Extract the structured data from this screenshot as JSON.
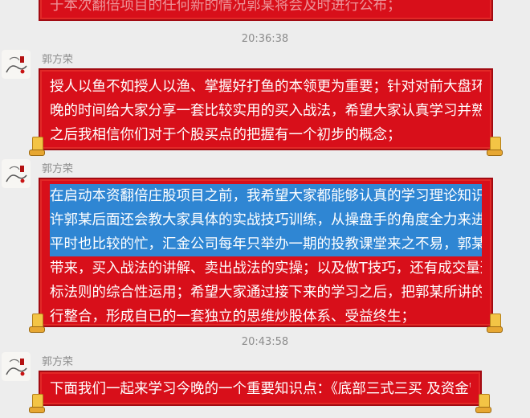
{
  "chat": {
    "messages": [
      {
        "kind": "text",
        "partial": true,
        "lines": [
          "于本次翻倍项目的任何新的情况郭某将会及时进行公布；"
        ]
      },
      {
        "kind": "time",
        "text": "20:36:38"
      },
      {
        "kind": "text",
        "sender": "郭方荣",
        "lines": [
          "授人以鱼不如授人以渔、掌握好打鱼的本领更为重要；针对对前大盘环境郭某利用今",
          "晚的时间给大家分享一套比较实用的买入战法，希望大家认真学习并熟练掌握；学完",
          "之后我相信你们对于个股买点的把握有一个初步的概念；"
        ]
      },
      {
        "kind": "text",
        "sender": "郭方荣",
        "highlighted_lines": [
          "在启动本资翻倍庄股项目之前，我希望大家都能够认真的学习理论知识，如果时间允",
          "许郭某后面还会教大家具体的实战技巧训练，从操盘手的角度全力来进行打造；郭某",
          "平时也比较的忙，汇金公司每年只举办一期的投教课堂来之不易，郭某会相继给大家"
        ],
        "lines": [
          "带来，买入战法的讲解、卖出战法的实操；以及做T技巧，还有成交量选股、及各种指",
          "标法则的综合性运用；希望大家通过接下来的学习之后，把郭某所讲的零碎知识点进",
          "行整合，形成自已的一套独立的思维炒股体系、受益终生；"
        ]
      },
      {
        "kind": "time",
        "text": "20:43:58"
      },
      {
        "kind": "text",
        "sender": "郭方荣",
        "lines": [
          "下面我们一起来学习今晚的一个重要知识点：《底部三式三买 及资金管理》"
        ]
      }
    ]
  },
  "colors": {
    "background": "#ededed",
    "bubble_fill": "#d80f1a",
    "bubble_border": "#a20a12",
    "selection_highlight": "#2f86d3",
    "scroll_ornament": "#f3c445"
  }
}
